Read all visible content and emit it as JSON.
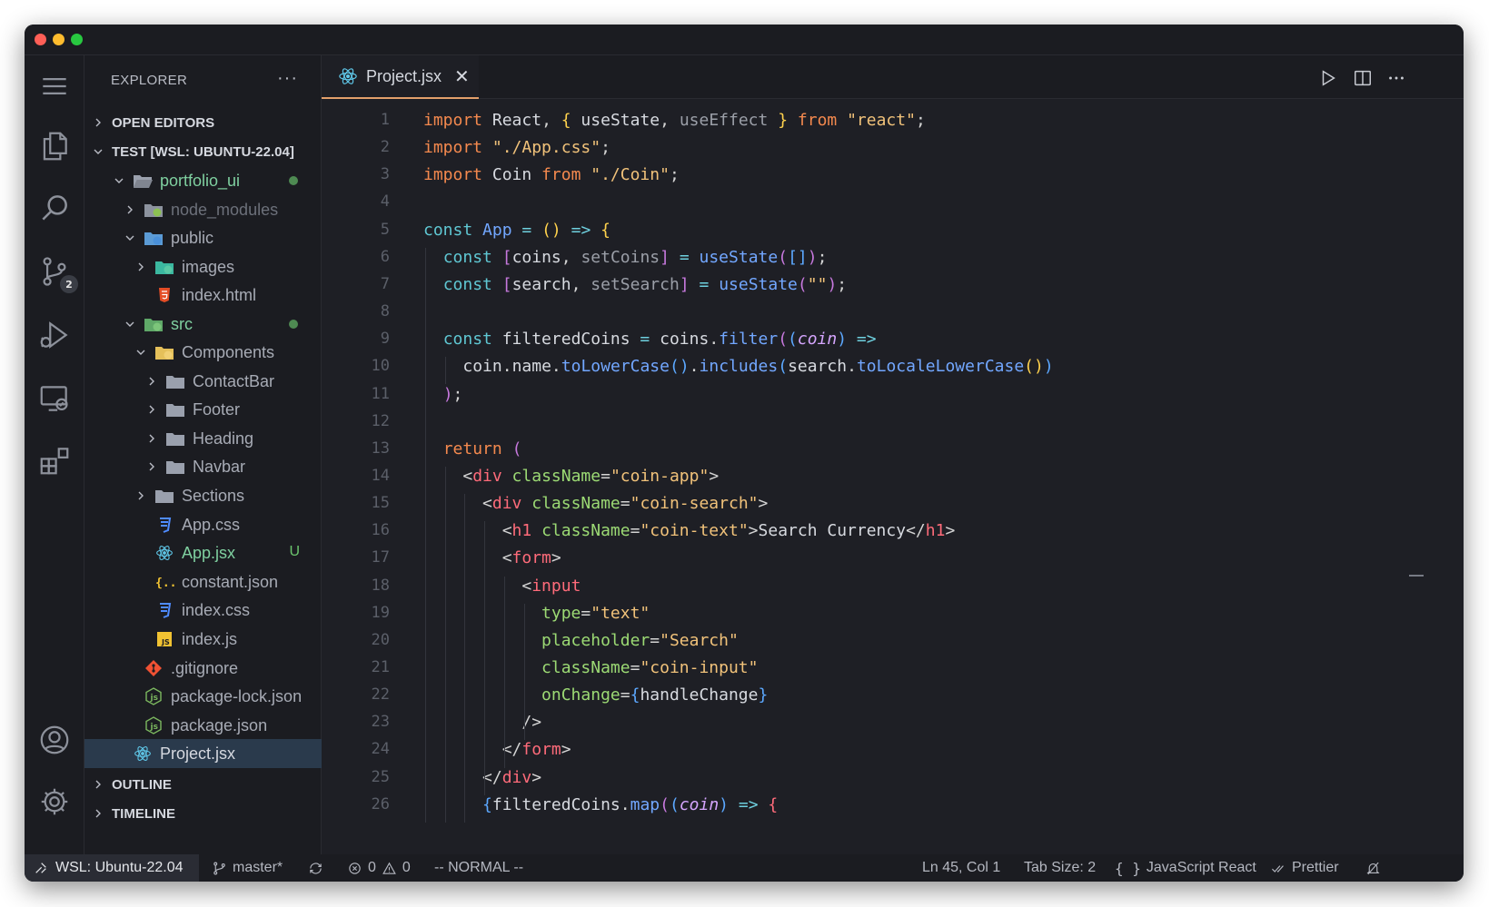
{
  "explorer": {
    "title": "EXPLORER",
    "more": "···",
    "sections": {
      "open_editors": "OPEN EDITORS",
      "workspace": "TEST [WSL: UBUNTU-22.04]",
      "outline": "OUTLINE",
      "timeline": "TIMELINE"
    },
    "tree": [
      {
        "label": "portfolio_ui",
        "color": "#7fd0a0"
      },
      {
        "label": "node_modules",
        "color": "#6c707a"
      },
      {
        "label": "public",
        "color": "#a7abb5"
      },
      {
        "label": "images",
        "color": "#a7abb5"
      },
      {
        "label": "index.html",
        "color": "#a7abb5"
      },
      {
        "label": "src",
        "color": "#7fd0a0"
      },
      {
        "label": "Components",
        "color": "#a7abb5"
      },
      {
        "label": "ContactBar",
        "color": "#a7abb5"
      },
      {
        "label": "Footer",
        "color": "#a7abb5"
      },
      {
        "label": "Heading",
        "color": "#a7abb5"
      },
      {
        "label": "Navbar",
        "color": "#a7abb5"
      },
      {
        "label": "Sections",
        "color": "#a7abb5"
      },
      {
        "label": "App.css",
        "color": "#a7abb5"
      },
      {
        "label": "App.jsx",
        "color": "#7fd0a0",
        "badge": "U"
      },
      {
        "label": "constant.json",
        "color": "#a7abb5"
      },
      {
        "label": "index.css",
        "color": "#a7abb5"
      },
      {
        "label": "index.js",
        "color": "#a7abb5"
      },
      {
        "label": ".gitignore",
        "color": "#a7abb5"
      },
      {
        "label": "package-lock.json",
        "color": "#a7abb5"
      },
      {
        "label": "package.json",
        "color": "#a7abb5"
      },
      {
        "label": "Project.jsx",
        "color": "#d5d8df"
      }
    ]
  },
  "activity": {
    "source_control_badge": "2"
  },
  "tabs": [
    {
      "label": "Project.jsx",
      "close": "✕"
    }
  ],
  "editor": {
    "line_numbers": [
      "1",
      "2",
      "3",
      "4",
      "5",
      "6",
      "7",
      "8",
      "9",
      "10",
      "11",
      "12",
      "13",
      "14",
      "15",
      "16",
      "17",
      "18",
      "19",
      "20",
      "21",
      "22",
      "23",
      "24",
      "25",
      "26"
    ],
    "lines": [
      [
        [
          "kw",
          "import"
        ],
        [
          "vr",
          " React"
        ],
        [
          "pu",
          ", "
        ],
        [
          "br1",
          "{"
        ],
        [
          "vr",
          " useState"
        ],
        [
          "pu",
          ", "
        ],
        [
          "dm",
          "useEffect"
        ],
        [
          "pu",
          " "
        ],
        [
          "br1",
          "}"
        ],
        [
          "kw",
          " from"
        ],
        [
          "st",
          " \"react\""
        ],
        [
          "pu",
          ";"
        ]
      ],
      [
        [
          "kw",
          "import"
        ],
        [
          "st",
          " \"./App.css\""
        ],
        [
          "pu",
          ";"
        ]
      ],
      [
        [
          "kw",
          "import"
        ],
        [
          "vr",
          " Coin"
        ],
        [
          "kw",
          " from"
        ],
        [
          "st",
          " \"./Coin\""
        ],
        [
          "pu",
          ";"
        ]
      ],
      [],
      [
        [
          "kw2",
          "const"
        ],
        [
          "fn",
          " App"
        ],
        [
          "op",
          " ="
        ],
        [
          "pu",
          " "
        ],
        [
          "br1",
          "()"
        ],
        [
          "op",
          " =>"
        ],
        [
          "pu",
          " "
        ],
        [
          "br1",
          "{"
        ]
      ],
      [
        [
          "pu",
          "  "
        ],
        [
          "kw2",
          "const"
        ],
        [
          "pu",
          " "
        ],
        [
          "br2",
          "["
        ],
        [
          "vr",
          "coins"
        ],
        [
          "pu",
          ", "
        ],
        [
          "dm",
          "setCoins"
        ],
        [
          "br2",
          "]"
        ],
        [
          "op",
          " ="
        ],
        [
          "fn",
          " useState"
        ],
        [
          "br2",
          "("
        ],
        [
          "br3",
          "[]"
        ],
        [
          "br2",
          ")"
        ],
        [
          "pu",
          ";"
        ]
      ],
      [
        [
          "pu",
          "  "
        ],
        [
          "kw2",
          "const"
        ],
        [
          "pu",
          " "
        ],
        [
          "br2",
          "["
        ],
        [
          "vr",
          "search"
        ],
        [
          "pu",
          ", "
        ],
        [
          "dm",
          "setSearch"
        ],
        [
          "br2",
          "]"
        ],
        [
          "op",
          " ="
        ],
        [
          "fn",
          " useState"
        ],
        [
          "br2",
          "("
        ],
        [
          "st",
          "\"\""
        ],
        [
          "br2",
          ")"
        ],
        [
          "pu",
          ";"
        ]
      ],
      [],
      [
        [
          "pu",
          "  "
        ],
        [
          "kw2",
          "const"
        ],
        [
          "vr",
          " filteredCoins"
        ],
        [
          "op",
          " ="
        ],
        [
          "vr",
          " coins"
        ],
        [
          "pu",
          "."
        ],
        [
          "fn",
          "filter"
        ],
        [
          "br2",
          "("
        ],
        [
          "br3",
          "("
        ],
        [
          "pm",
          "coin"
        ],
        [
          "br3",
          ")"
        ],
        [
          "op",
          " =>"
        ]
      ],
      [
        [
          "pu",
          "    "
        ],
        [
          "vr",
          "coin"
        ],
        [
          "pu",
          "."
        ],
        [
          "vr",
          "name"
        ],
        [
          "pu",
          "."
        ],
        [
          "fn",
          "toLowerCase"
        ],
        [
          "br3",
          "()"
        ],
        [
          "pu",
          "."
        ],
        [
          "fn",
          "includes"
        ],
        [
          "br3",
          "("
        ],
        [
          "vr",
          "search"
        ],
        [
          "pu",
          "."
        ],
        [
          "fn",
          "toLocaleLowerCase"
        ],
        [
          "br1",
          "()"
        ],
        [
          "br3",
          ")"
        ]
      ],
      [
        [
          "pu",
          "  "
        ],
        [
          "br2",
          ")"
        ],
        [
          "pu",
          ";"
        ]
      ],
      [],
      [
        [
          "pu",
          "  "
        ],
        [
          "kw",
          "return"
        ],
        [
          "pu",
          " "
        ],
        [
          "br2",
          "("
        ]
      ],
      [
        [
          "pu",
          "    "
        ],
        [
          "pu",
          "<"
        ],
        [
          "tg",
          "div"
        ],
        [
          "at",
          " className"
        ],
        [
          "pu",
          "="
        ],
        [
          "st",
          "\"coin-app\""
        ],
        [
          "pu",
          ">"
        ]
      ],
      [
        [
          "pu",
          "      "
        ],
        [
          "pu",
          "<"
        ],
        [
          "tg",
          "div"
        ],
        [
          "at",
          " className"
        ],
        [
          "pu",
          "="
        ],
        [
          "st",
          "\"coin-search\""
        ],
        [
          "pu",
          ">"
        ]
      ],
      [
        [
          "pu",
          "        "
        ],
        [
          "pu",
          "<"
        ],
        [
          "tg",
          "h1"
        ],
        [
          "at",
          " className"
        ],
        [
          "pu",
          "="
        ],
        [
          "st",
          "\"coin-text\""
        ],
        [
          "pu",
          ">"
        ],
        [
          "vr",
          "Search Currency"
        ],
        [
          "pu",
          "</"
        ],
        [
          "tg",
          "h1"
        ],
        [
          "pu",
          ">"
        ]
      ],
      [
        [
          "pu",
          "        "
        ],
        [
          "pu",
          "<"
        ],
        [
          "tg",
          "form"
        ],
        [
          "pu",
          ">"
        ]
      ],
      [
        [
          "pu",
          "          "
        ],
        [
          "pu",
          "<"
        ],
        [
          "tg",
          "input"
        ]
      ],
      [
        [
          "pu",
          "            "
        ],
        [
          "at",
          "type"
        ],
        [
          "pu",
          "="
        ],
        [
          "st",
          "\"text\""
        ]
      ],
      [
        [
          "pu",
          "            "
        ],
        [
          "at",
          "placeholder"
        ],
        [
          "pu",
          "="
        ],
        [
          "st",
          "\"Search\""
        ]
      ],
      [
        [
          "pu",
          "            "
        ],
        [
          "at",
          "className"
        ],
        [
          "pu",
          "="
        ],
        [
          "st",
          "\"coin-input\""
        ]
      ],
      [
        [
          "pu",
          "            "
        ],
        [
          "at",
          "onChange"
        ],
        [
          "pu",
          "="
        ],
        [
          "br3",
          "{"
        ],
        [
          "vr",
          "handleChange"
        ],
        [
          "br3",
          "}"
        ]
      ],
      [
        [
          "pu",
          "          "
        ],
        [
          "pu",
          "/>"
        ]
      ],
      [
        [
          "pu",
          "        "
        ],
        [
          "pu",
          "</"
        ],
        [
          "tg",
          "form"
        ],
        [
          "pu",
          ">"
        ]
      ],
      [
        [
          "pu",
          "      "
        ],
        [
          "pu",
          "</"
        ],
        [
          "tg",
          "div"
        ],
        [
          "pu",
          ">"
        ]
      ],
      [
        [
          "pu",
          "      "
        ],
        [
          "br3",
          "{"
        ],
        [
          "vr",
          "filteredCoins"
        ],
        [
          "pu",
          "."
        ],
        [
          "fn",
          "map"
        ],
        [
          "br2",
          "("
        ],
        [
          "br3",
          "("
        ],
        [
          "pm",
          "coin"
        ],
        [
          "br3",
          ")"
        ],
        [
          "op",
          " =>"
        ],
        [
          "pu",
          " "
        ],
        [
          "tg",
          "{"
        ]
      ]
    ]
  },
  "statusbar": {
    "remote": "WSL: Ubuntu-22.04",
    "branch": "master*",
    "errors": "0",
    "warnings": "0",
    "mode": "-- NORMAL --",
    "position": "Ln 45, Col 1",
    "tab_size": "Tab Size: 2",
    "language": "JavaScript React",
    "formatter": "Prettier"
  },
  "colors": {
    "window_bg": "#1e1f25",
    "sidebar_bg": "#1b1c21",
    "accent": "#e3a06b",
    "selection": "#2a3a4c"
  }
}
